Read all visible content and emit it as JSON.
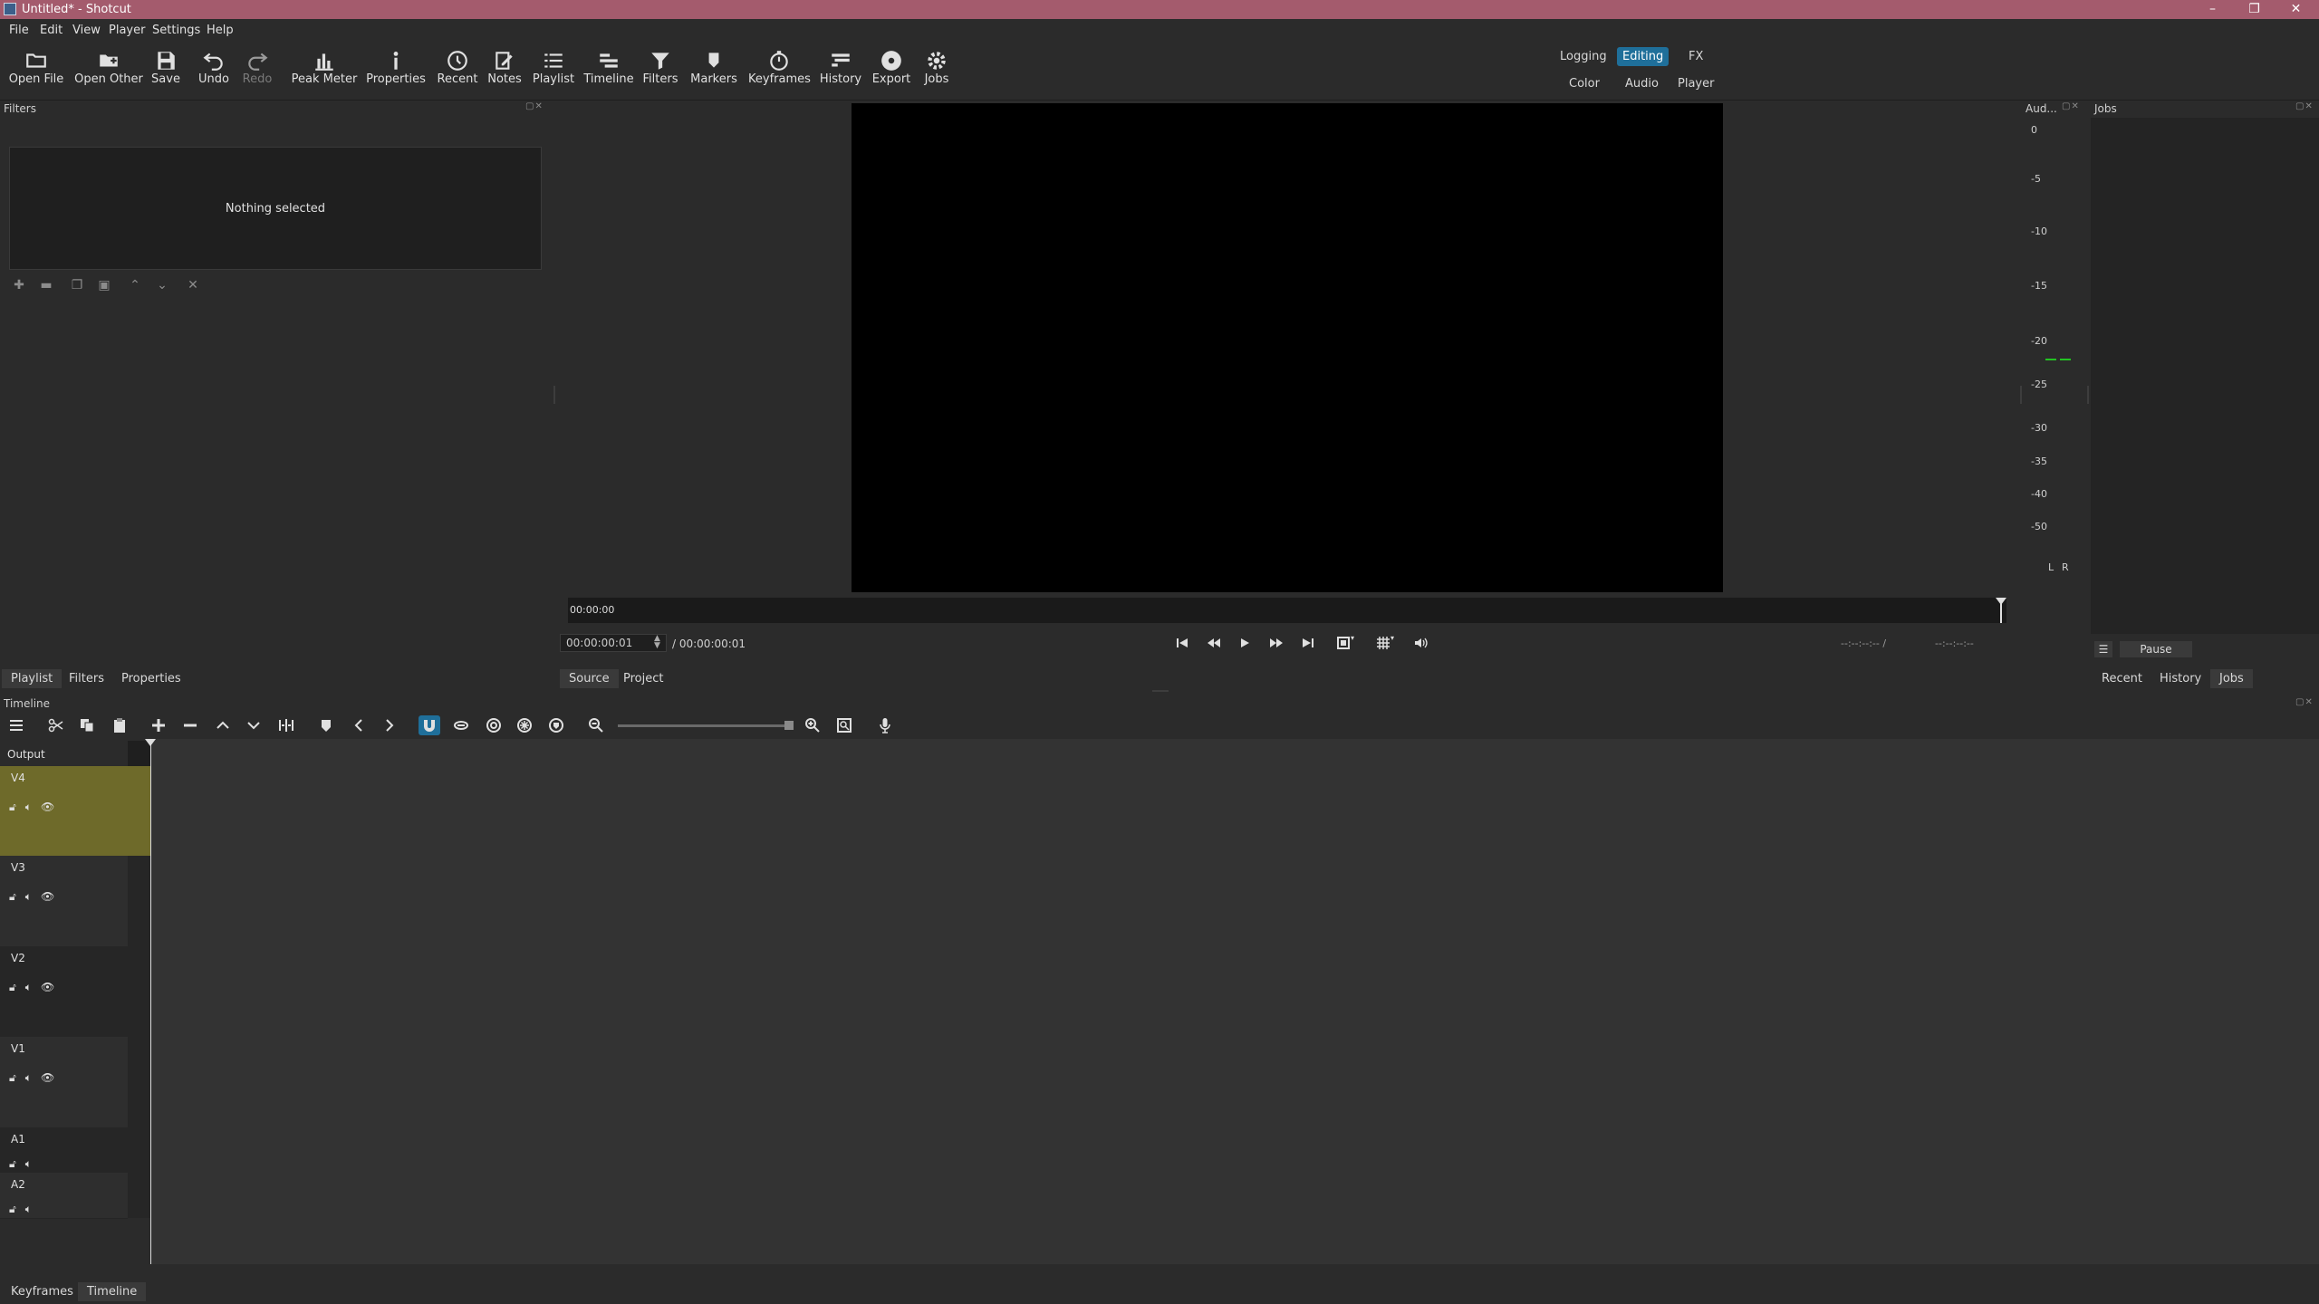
{
  "window": {
    "title": "Untitled* - Shotcut",
    "min": "–",
    "max": "❐",
    "close": "✕"
  },
  "menu": [
    "File",
    "Edit",
    "View",
    "Player",
    "Settings",
    "Help"
  ],
  "toolbar": [
    {
      "label": "Open File",
      "icon": "open-file-icon"
    },
    {
      "label": "Open Other",
      "icon": "open-other-icon"
    },
    {
      "label": "Save",
      "icon": "save-icon"
    },
    {
      "label": "Undo",
      "icon": "undo-icon"
    },
    {
      "label": "Redo",
      "icon": "redo-icon",
      "disabled": true
    },
    {
      "label": "Peak Meter",
      "icon": "peak-meter-icon"
    },
    {
      "label": "Properties",
      "icon": "properties-icon"
    },
    {
      "label": "Recent",
      "icon": "recent-icon"
    },
    {
      "label": "Notes",
      "icon": "notes-icon"
    },
    {
      "label": "Playlist",
      "icon": "playlist-icon"
    },
    {
      "label": "Timeline",
      "icon": "timeline-icon"
    },
    {
      "label": "Filters",
      "icon": "filters-icon"
    },
    {
      "label": "Markers",
      "icon": "markers-icon"
    },
    {
      "label": "Keyframes",
      "icon": "keyframes-icon"
    },
    {
      "label": "History",
      "icon": "history-icon"
    },
    {
      "label": "Export",
      "icon": "export-icon"
    },
    {
      "label": "Jobs",
      "icon": "jobs-icon"
    }
  ],
  "layouts": {
    "row1": [
      "Logging",
      "Editing",
      "FX"
    ],
    "row2": [
      "Color",
      "Audio",
      "Player"
    ],
    "active": "Editing"
  },
  "filters_panel": {
    "title": "Filters",
    "empty_message": "Nothing selected"
  },
  "left_tabs": [
    "Playlist",
    "Filters",
    "Properties"
  ],
  "player": {
    "scrub_time": "00:00:00",
    "timecode": "00:00:00:01",
    "duration": "/ 00:00:00:01",
    "in_point": "--:--:--:-- /",
    "out_point": "--:--:--:--",
    "tabs": [
      "Source",
      "Project"
    ]
  },
  "audio_meter": {
    "title": "Aud...",
    "scale": [
      "0",
      "-5",
      "-10",
      "-15",
      "-20",
      "-25",
      "-30",
      "-35",
      "-40",
      "-50"
    ],
    "channels": [
      "L",
      "R"
    ]
  },
  "jobs_panel": {
    "title": "Jobs",
    "pause_label": "Pause",
    "tabs": [
      "Recent",
      "History",
      "Jobs"
    ]
  },
  "timeline": {
    "title": "Timeline",
    "output_label": "Output",
    "tracks": [
      {
        "name": "V4",
        "type": "video",
        "selected": true
      },
      {
        "name": "V3",
        "type": "video"
      },
      {
        "name": "V2",
        "type": "video"
      },
      {
        "name": "V1",
        "type": "video"
      },
      {
        "name": "A1",
        "type": "audio"
      },
      {
        "name": "A2",
        "type": "audio"
      }
    ]
  },
  "bottom_tabs": [
    "Keyframes",
    "Timeline"
  ],
  "colors": {
    "titlebar": "#a45b6d",
    "accent": "#1f6f9a",
    "selected_track": "#6e6a2a",
    "meter_level": "#22c322"
  }
}
